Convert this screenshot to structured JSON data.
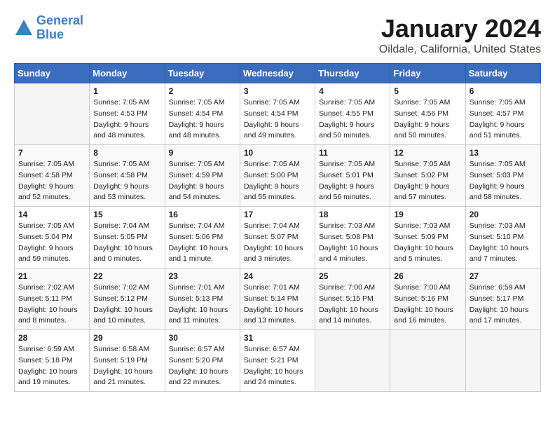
{
  "header": {
    "logo_line1": "General",
    "logo_line2": "Blue",
    "month_year": "January 2024",
    "location": "Oildale, California, United States"
  },
  "weekdays": [
    "Sunday",
    "Monday",
    "Tuesday",
    "Wednesday",
    "Thursday",
    "Friday",
    "Saturday"
  ],
  "weeks": [
    [
      {
        "day": "",
        "empty": true
      },
      {
        "day": "1",
        "sunrise": "Sunrise: 7:05 AM",
        "sunset": "Sunset: 4:53 PM",
        "daylight": "Daylight: 9 hours and 48 minutes."
      },
      {
        "day": "2",
        "sunrise": "Sunrise: 7:05 AM",
        "sunset": "Sunset: 4:54 PM",
        "daylight": "Daylight: 9 hours and 48 minutes."
      },
      {
        "day": "3",
        "sunrise": "Sunrise: 7:05 AM",
        "sunset": "Sunset: 4:54 PM",
        "daylight": "Daylight: 9 hours and 49 minutes."
      },
      {
        "day": "4",
        "sunrise": "Sunrise: 7:05 AM",
        "sunset": "Sunset: 4:55 PM",
        "daylight": "Daylight: 9 hours and 50 minutes."
      },
      {
        "day": "5",
        "sunrise": "Sunrise: 7:05 AM",
        "sunset": "Sunset: 4:56 PM",
        "daylight": "Daylight: 9 hours and 50 minutes."
      },
      {
        "day": "6",
        "sunrise": "Sunrise: 7:05 AM",
        "sunset": "Sunset: 4:57 PM",
        "daylight": "Daylight: 9 hours and 51 minutes."
      }
    ],
    [
      {
        "day": "7",
        "sunrise": "Sunrise: 7:05 AM",
        "sunset": "Sunset: 4:58 PM",
        "daylight": "Daylight: 9 hours and 52 minutes."
      },
      {
        "day": "8",
        "sunrise": "Sunrise: 7:05 AM",
        "sunset": "Sunset: 4:58 PM",
        "daylight": "Daylight: 9 hours and 53 minutes."
      },
      {
        "day": "9",
        "sunrise": "Sunrise: 7:05 AM",
        "sunset": "Sunset: 4:59 PM",
        "daylight": "Daylight: 9 hours and 54 minutes."
      },
      {
        "day": "10",
        "sunrise": "Sunrise: 7:05 AM",
        "sunset": "Sunset: 5:00 PM",
        "daylight": "Daylight: 9 hours and 55 minutes."
      },
      {
        "day": "11",
        "sunrise": "Sunrise: 7:05 AM",
        "sunset": "Sunset: 5:01 PM",
        "daylight": "Daylight: 9 hours and 56 minutes."
      },
      {
        "day": "12",
        "sunrise": "Sunrise: 7:05 AM",
        "sunset": "Sunset: 5:02 PM",
        "daylight": "Daylight: 9 hours and 57 minutes."
      },
      {
        "day": "13",
        "sunrise": "Sunrise: 7:05 AM",
        "sunset": "Sunset: 5:03 PM",
        "daylight": "Daylight: 9 hours and 58 minutes."
      }
    ],
    [
      {
        "day": "14",
        "sunrise": "Sunrise: 7:05 AM",
        "sunset": "Sunset: 5:04 PM",
        "daylight": "Daylight: 9 hours and 59 minutes."
      },
      {
        "day": "15",
        "sunrise": "Sunrise: 7:04 AM",
        "sunset": "Sunset: 5:05 PM",
        "daylight": "Daylight: 10 hours and 0 minutes."
      },
      {
        "day": "16",
        "sunrise": "Sunrise: 7:04 AM",
        "sunset": "Sunset: 5:06 PM",
        "daylight": "Daylight: 10 hours and 1 minute."
      },
      {
        "day": "17",
        "sunrise": "Sunrise: 7:04 AM",
        "sunset": "Sunset: 5:07 PM",
        "daylight": "Daylight: 10 hours and 3 minutes."
      },
      {
        "day": "18",
        "sunrise": "Sunrise: 7:03 AM",
        "sunset": "Sunset: 5:08 PM",
        "daylight": "Daylight: 10 hours and 4 minutes."
      },
      {
        "day": "19",
        "sunrise": "Sunrise: 7:03 AM",
        "sunset": "Sunset: 5:09 PM",
        "daylight": "Daylight: 10 hours and 5 minutes."
      },
      {
        "day": "20",
        "sunrise": "Sunrise: 7:03 AM",
        "sunset": "Sunset: 5:10 PM",
        "daylight": "Daylight: 10 hours and 7 minutes."
      }
    ],
    [
      {
        "day": "21",
        "sunrise": "Sunrise: 7:02 AM",
        "sunset": "Sunset: 5:11 PM",
        "daylight": "Daylight: 10 hours and 8 minutes."
      },
      {
        "day": "22",
        "sunrise": "Sunrise: 7:02 AM",
        "sunset": "Sunset: 5:12 PM",
        "daylight": "Daylight: 10 hours and 10 minutes."
      },
      {
        "day": "23",
        "sunrise": "Sunrise: 7:01 AM",
        "sunset": "Sunset: 5:13 PM",
        "daylight": "Daylight: 10 hours and 11 minutes."
      },
      {
        "day": "24",
        "sunrise": "Sunrise: 7:01 AM",
        "sunset": "Sunset: 5:14 PM",
        "daylight": "Daylight: 10 hours and 13 minutes."
      },
      {
        "day": "25",
        "sunrise": "Sunrise: 7:00 AM",
        "sunset": "Sunset: 5:15 PM",
        "daylight": "Daylight: 10 hours and 14 minutes."
      },
      {
        "day": "26",
        "sunrise": "Sunrise: 7:00 AM",
        "sunset": "Sunset: 5:16 PM",
        "daylight": "Daylight: 10 hours and 16 minutes."
      },
      {
        "day": "27",
        "sunrise": "Sunrise: 6:59 AM",
        "sunset": "Sunset: 5:17 PM",
        "daylight": "Daylight: 10 hours and 17 minutes."
      }
    ],
    [
      {
        "day": "28",
        "sunrise": "Sunrise: 6:59 AM",
        "sunset": "Sunset: 5:18 PM",
        "daylight": "Daylight: 10 hours and 19 minutes."
      },
      {
        "day": "29",
        "sunrise": "Sunrise: 6:58 AM",
        "sunset": "Sunset: 5:19 PM",
        "daylight": "Daylight: 10 hours and 21 minutes."
      },
      {
        "day": "30",
        "sunrise": "Sunrise: 6:57 AM",
        "sunset": "Sunset: 5:20 PM",
        "daylight": "Daylight: 10 hours and 22 minutes."
      },
      {
        "day": "31",
        "sunrise": "Sunrise: 6:57 AM",
        "sunset": "Sunset: 5:21 PM",
        "daylight": "Daylight: 10 hours and 24 minutes."
      },
      {
        "day": "",
        "empty": true
      },
      {
        "day": "",
        "empty": true
      },
      {
        "day": "",
        "empty": true
      }
    ]
  ]
}
